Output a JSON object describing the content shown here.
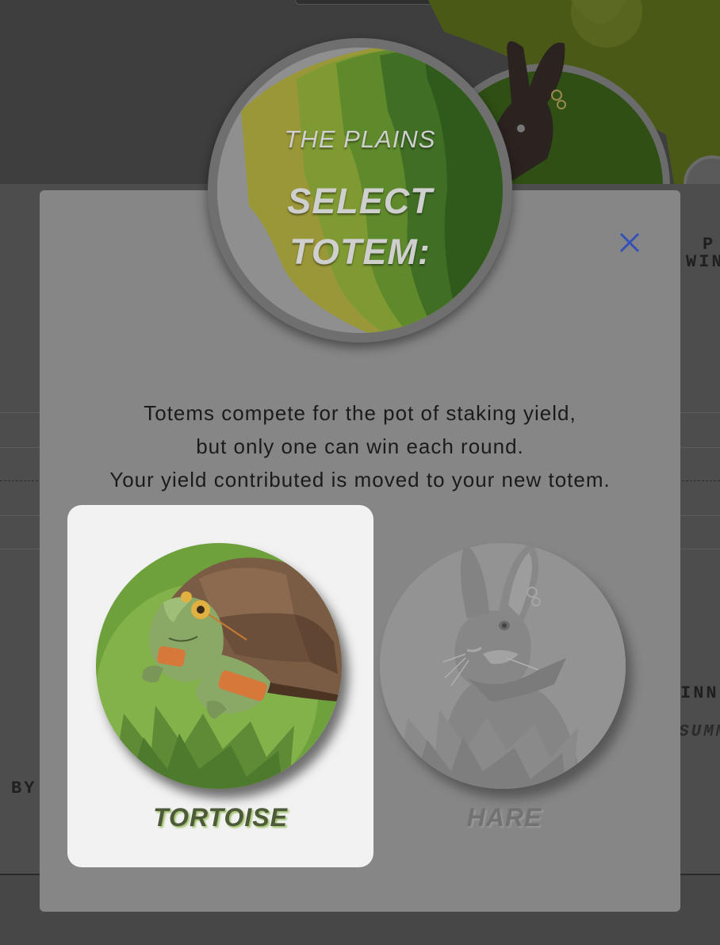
{
  "background": {
    "partial_label_1": "P",
    "partial_label_2": "WIN",
    "partial_label_3": "INN",
    "partial_label_4": "SUMM",
    "partial_label_5": "BY"
  },
  "modal": {
    "close_icon": "close-icon",
    "header": {
      "subtitle": "THE PLAINS",
      "title_line1": "SELECT",
      "title_line2": "TOTEM:"
    },
    "description": [
      "Totems compete for the pot of staking yield,",
      "but only one can win each round.",
      "Your yield contributed is moved to your new totem."
    ],
    "totems": [
      {
        "label": "TORTOISE",
        "icon": "tortoise-icon",
        "selected": true
      },
      {
        "label": "HARE",
        "icon": "hare-icon",
        "selected": false
      }
    ]
  },
  "colors": {
    "close_icon": "#3550b8",
    "selected_card": "#f2f2f2",
    "plains_green": "#6ea03c",
    "overlay": "#868686"
  }
}
